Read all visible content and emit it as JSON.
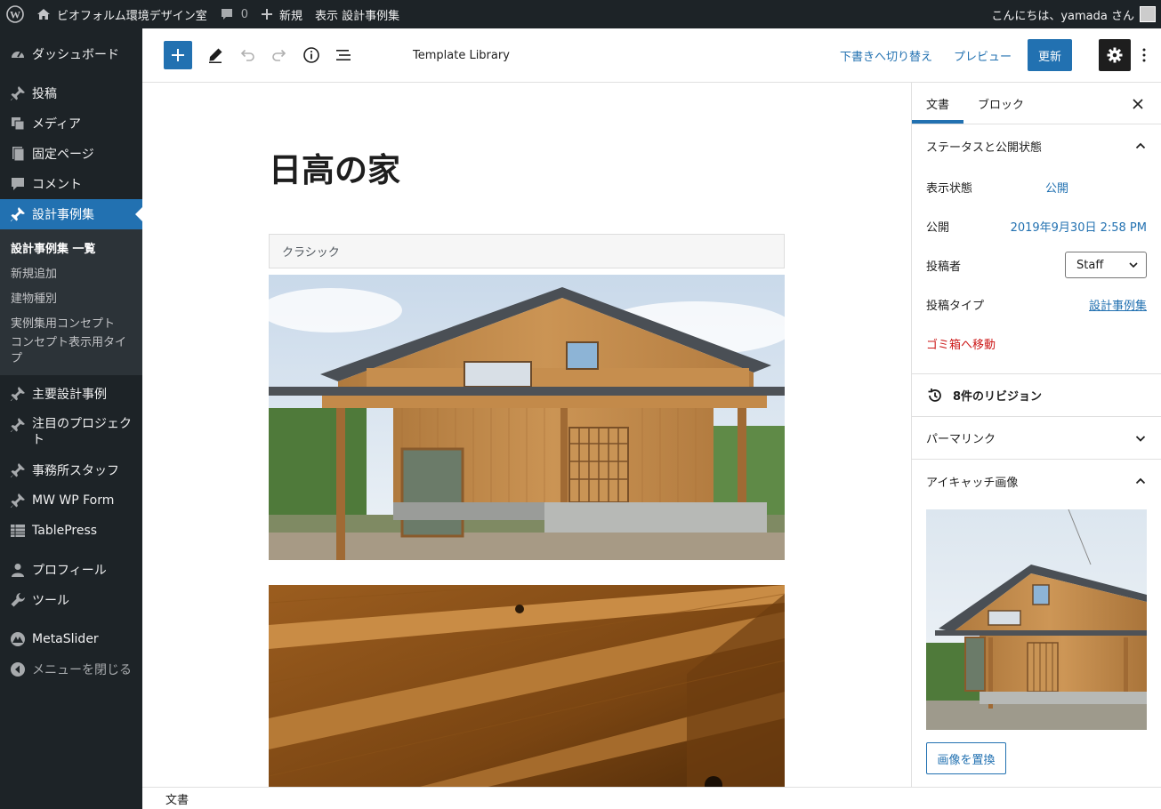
{
  "adminbar": {
    "site_name": "ビオフォルム環境デザイン室",
    "comments_count": "0",
    "new_label": "新規",
    "view_label": "表示 設計事例集",
    "greeting": "こんにちは、yamada さん"
  },
  "menu": {
    "dashboard": "ダッシュボード",
    "posts": "投稿",
    "media": "メディア",
    "pages": "固定ページ",
    "comments": "コメント",
    "cases": "設計事例集",
    "submenu": [
      "設計事例集 一覧",
      "新規追加",
      "建物種別",
      "実例集用コンセプト",
      "コンセプト表示用タイプ"
    ],
    "major": "主要設計事例",
    "featured_projects": "注目のプロジェクト",
    "staff": "事務所スタッフ",
    "mwwp": "MW WP Form",
    "tablepress": "TablePress",
    "profile": "プロフィール",
    "tools": "ツール",
    "metaslider": "MetaSlider",
    "collapse": "メニューを閉じる"
  },
  "header": {
    "template_library": "Template Library",
    "switch_draft": "下書きへ切り替え",
    "preview": "プレビュー",
    "update": "更新"
  },
  "content": {
    "title": "日高の家",
    "classic_label": "クラシック"
  },
  "footer": {
    "breadcrumb": "文書"
  },
  "sidebar": {
    "tab_document": "文書",
    "tab_block": "ブロック",
    "status_panel": "ステータスと公開状態",
    "visibility_label": "表示状態",
    "visibility_value": "公開",
    "publish_label": "公開",
    "publish_value": "2019年9月30日 2:58 PM",
    "author_label": "投稿者",
    "author_value": "Staff",
    "post_type_label": "投稿タイプ",
    "post_type_value": "設計事例集",
    "trash": "ゴミ箱へ移動",
    "revisions": "8件のリビジョン",
    "permalink": "パーマリンク",
    "featured_image": "アイキャッチ画像",
    "replace_image": "画像を置換"
  },
  "colors": {
    "accent": "#2271b1",
    "admin_bg": "#1d2327",
    "danger": "#cc1818"
  }
}
